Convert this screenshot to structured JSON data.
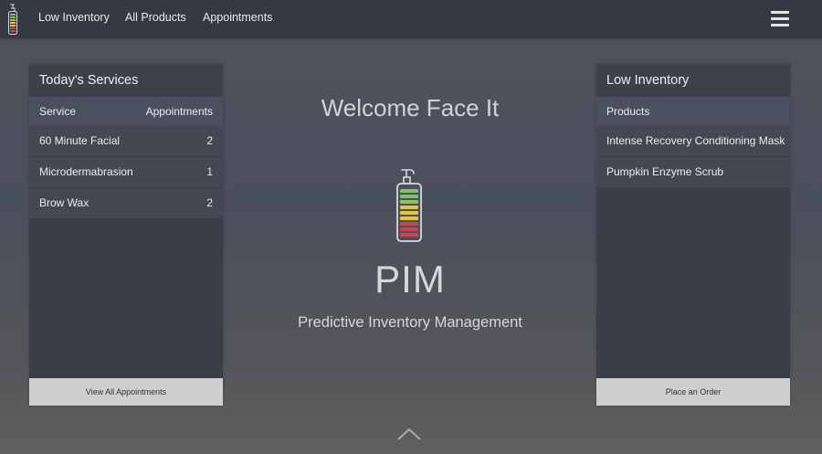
{
  "nav": {
    "links": [
      "Low Inventory",
      "All Products",
      "Appointments"
    ],
    "menu_icon": "hamburger-menu-icon",
    "logo_icon": "pump-bottle-icon"
  },
  "services": {
    "title": "Today's Services",
    "columns": [
      "Service",
      "Appointments"
    ],
    "rows": [
      {
        "service": "60 Minute Facial",
        "count": "2"
      },
      {
        "service": "Microdermabrasion",
        "count": "1"
      },
      {
        "service": "Brow Wax",
        "count": "2"
      }
    ],
    "button": "View All Appointments"
  },
  "low_inventory": {
    "title": "Low Inventory",
    "column": "Products",
    "rows": [
      "Intense Recovery Conditioning Mask",
      "Pumpkin Enzyme Scrub"
    ],
    "button": "Place an Order"
  },
  "main": {
    "welcome": "Welcome Face It",
    "logo_icon": "pump-bottle-inventory-icon",
    "title": "PIM",
    "subtitle": "Predictive Inventory Management",
    "scroll_icon": "chevron-up-icon"
  },
  "colors": {
    "navbar": "#353943",
    "panel": "#3a3e48",
    "panel_header": "#4a5060",
    "button": "#cfcfcf",
    "level_green": "#7fbf6a",
    "level_yellow": "#e6c43c",
    "level_red": "#c9474a"
  }
}
